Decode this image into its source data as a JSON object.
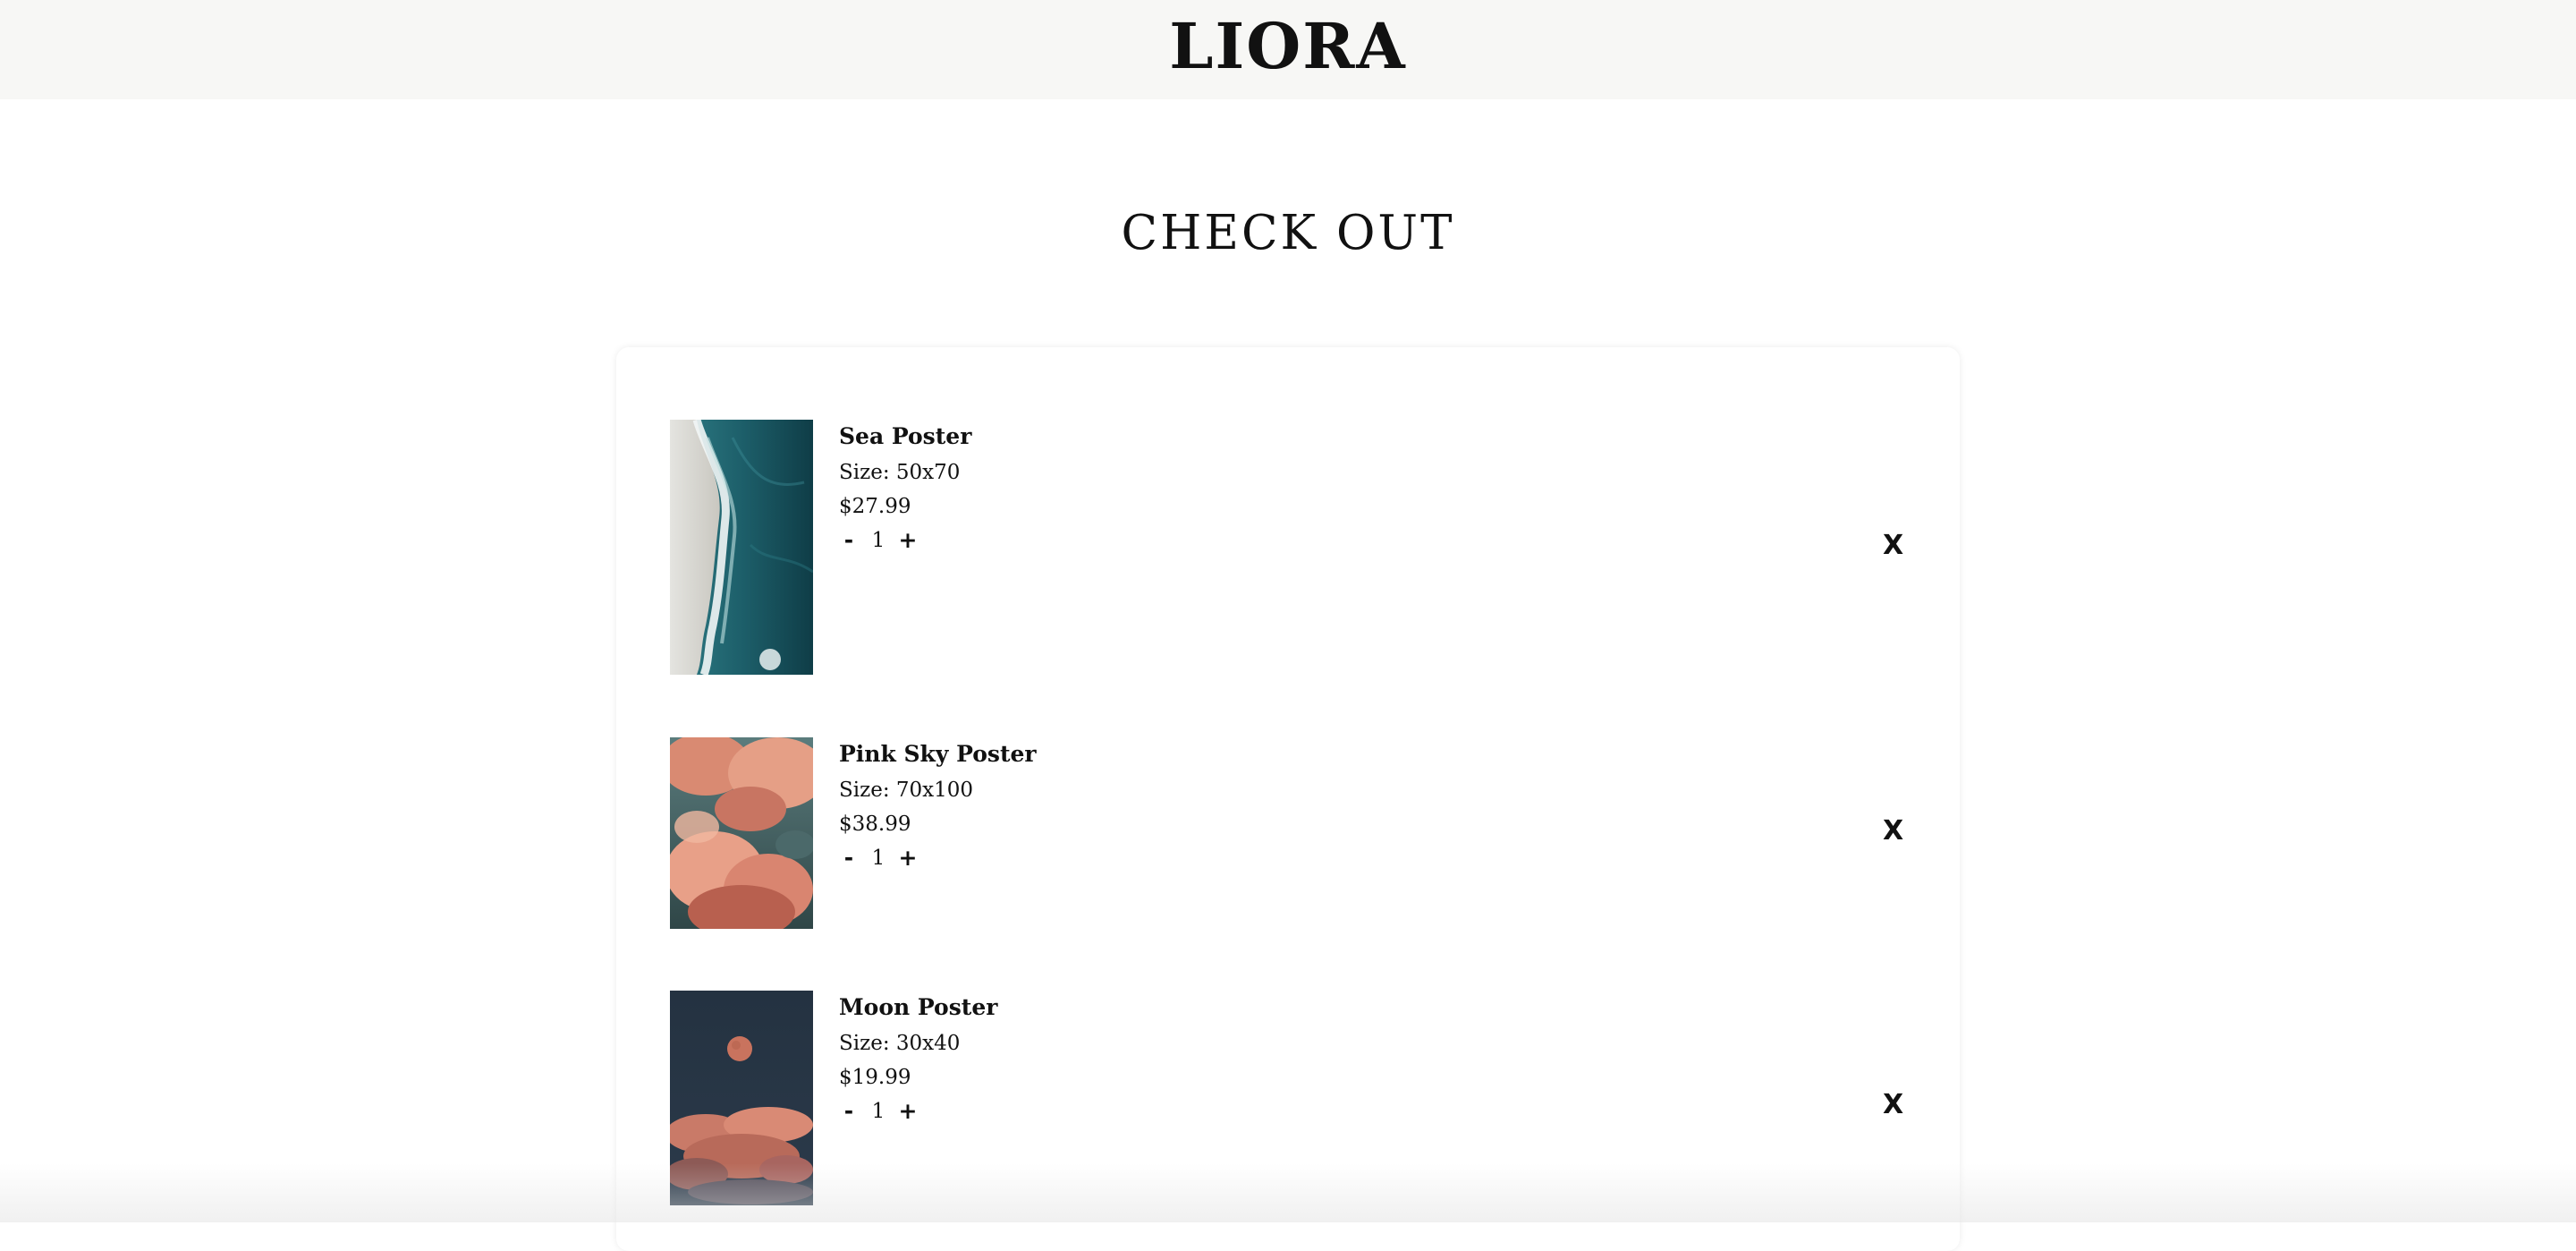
{
  "header": {
    "brand": "LIORA"
  },
  "page": {
    "title": "CHECK OUT"
  },
  "cart": {
    "items": [
      {
        "name": "Sea Poster",
        "size": "Size: 50x70",
        "price": "$27.99",
        "quantity": "1",
        "decrement": "-",
        "increment": "+",
        "remove": "X"
      },
      {
        "name": "Pink Sky Poster",
        "size": "Size: 70x100",
        "price": "$38.99",
        "quantity": "1",
        "decrement": "-",
        "increment": "+",
        "remove": "X"
      },
      {
        "name": "Moon Poster",
        "size": "Size: 30x40",
        "price": "$19.99",
        "quantity": "1",
        "decrement": "-",
        "increment": "+",
        "remove": "X"
      }
    ]
  },
  "colors": {
    "header_background": "#f7f7f5",
    "text": "#111111",
    "page_background": "#ffffff"
  }
}
